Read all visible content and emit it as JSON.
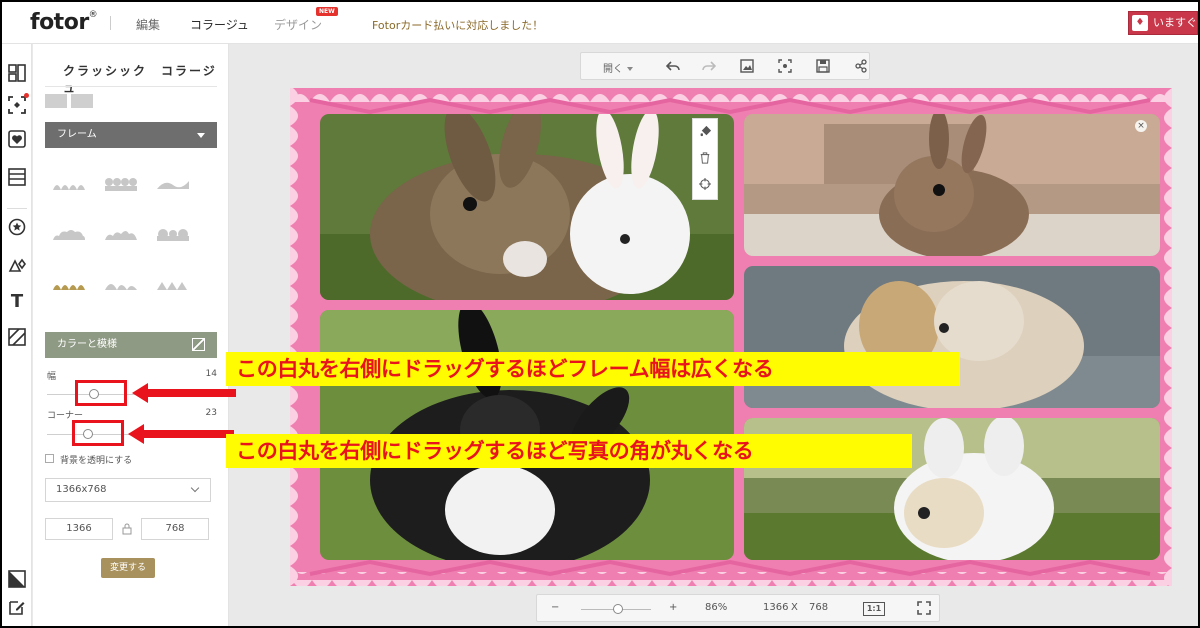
{
  "topbar": {
    "logo": "fotor",
    "logo_mark": "®",
    "nav": [
      {
        "label": "編集",
        "state": "normal"
      },
      {
        "label": "コラージュ",
        "state": "active"
      },
      {
        "label": "デザイン",
        "state": "muted"
      }
    ],
    "new_badge": "NEW",
    "promo": "Fotorカード払いに対応しました！",
    "upgrade_label": "いますぐ"
  },
  "panel": {
    "title": "クラッシック　コラージュ",
    "frame_dropdown": "フレーム",
    "color_section": "カラーと模様",
    "width_label": "幅",
    "width_value": "14",
    "corner_label": "コーナー",
    "corner_value": "23",
    "transparent_label": "背景を透明にする",
    "size_preset": "1366x768",
    "width_px": "1366",
    "height_px": "768",
    "apply_label": "変更する"
  },
  "toolbar": {
    "open_label": "開く"
  },
  "zoombar": {
    "minus": "−",
    "plus": "+",
    "zoom": "86%",
    "width": "1366",
    "x": "X",
    "height": "768",
    "one_to_one": "1:1"
  },
  "annotations": {
    "width_note": "この白丸を右側にドラッグするほどフレーム幅は広くなる",
    "corner_note": "この白丸を右側にドラッグするほど写真の角が丸くなる"
  },
  "colors": {
    "frame_pink": "#f07fb1",
    "annotation_red": "#e8131d",
    "annotation_yellow": "#fffb00",
    "apply_button": "#a8915c",
    "upgrade_button": "#c8374a"
  }
}
